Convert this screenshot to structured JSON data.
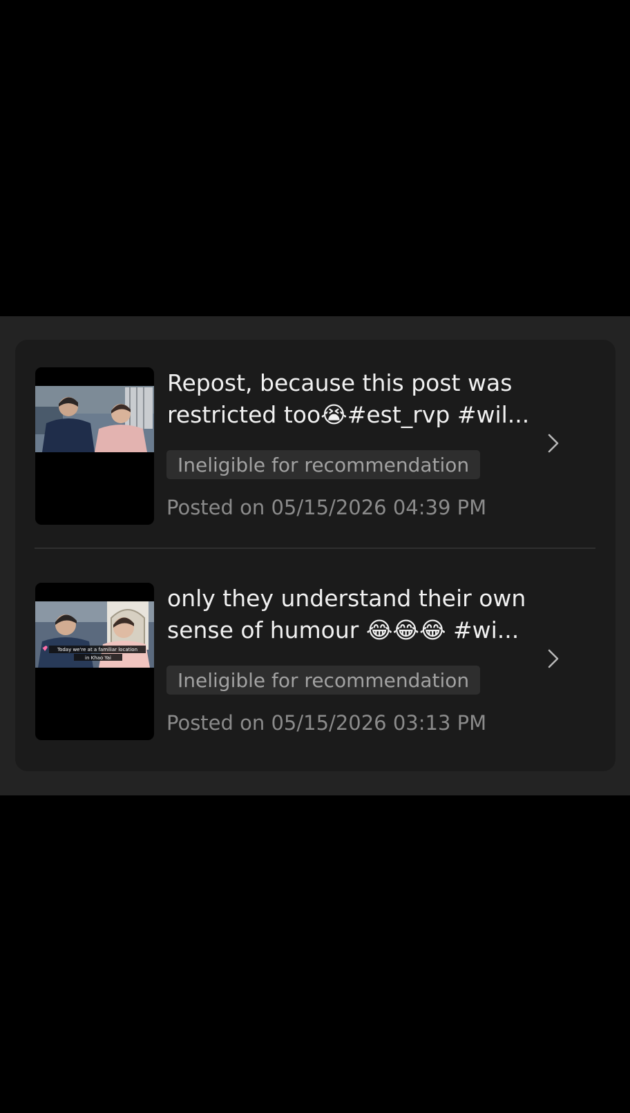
{
  "posts": [
    {
      "caption_line1": "Repost, because this post was",
      "caption_line2": "restricted too😭#est_rvp #wil...",
      "status_badge": "Ineligible for recommendation",
      "posted": "Posted on 05/15/2026 04:39 PM"
    },
    {
      "caption_line1": "only they understand their own",
      "caption_line2": "sense of humour 😂😂😂 #wi...",
      "status_badge": "Ineligible for recommendation",
      "posted": "Posted on 05/15/2026 03:13 PM",
      "thumb_overlay_line1": "Today we're at a familiar location",
      "thumb_overlay_line2": "in Khao Yai"
    }
  ],
  "icons": {
    "chevron": "chevron-right-icon"
  },
  "colors": {
    "background": "#000000",
    "panel": "#232323",
    "card": "#1b1b1b",
    "badge_bg": "#2e2e2e",
    "caption_text": "#f1f1f1",
    "badge_text": "#a2a2a2",
    "posted_text": "#8b8b8b"
  }
}
